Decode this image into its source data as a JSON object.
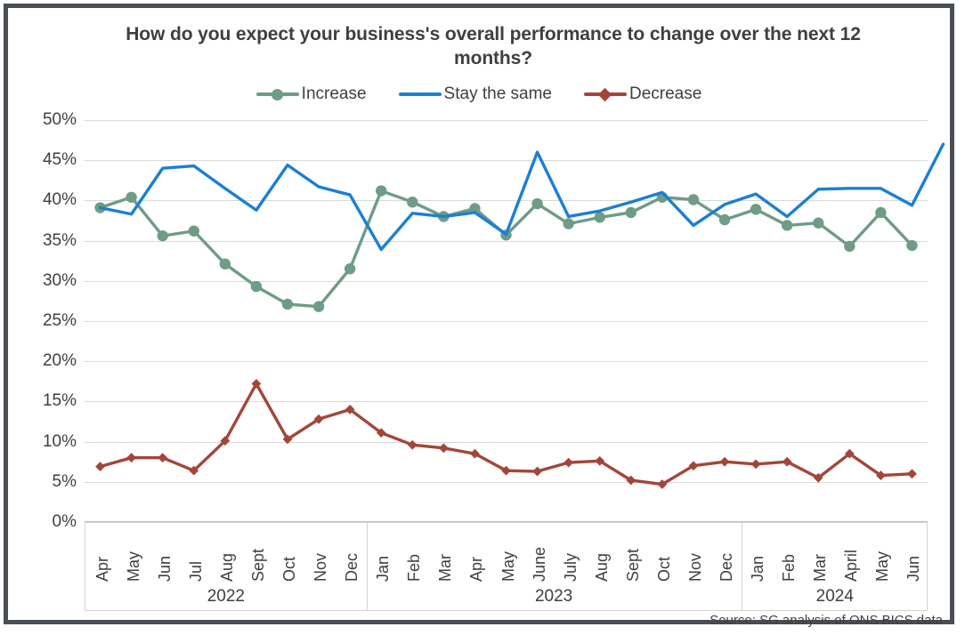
{
  "chart": {
    "title": "How do you expect your business's overall performance to change over the next 12 months?",
    "source": "Source: SG analysis of ONS BICS data"
  },
  "legend": {
    "items": [
      {
        "label": "Increase",
        "color": "#6e9c85",
        "marker": "circle"
      },
      {
        "label": "Stay the same",
        "color": "#1b7fd4",
        "marker": "line"
      },
      {
        "label": "Decrease",
        "color": "#a34639",
        "marker": "diamond"
      }
    ]
  },
  "yaxis": {
    "ticks": [
      "0%",
      "5%",
      "10%",
      "15%",
      "20%",
      "25%",
      "30%",
      "35%",
      "40%",
      "45%",
      "50%"
    ]
  },
  "years": [
    {
      "label": "2022",
      "count": 9
    },
    {
      "label": "2023",
      "count": 12
    },
    {
      "label": "2024",
      "count": 6
    }
  ],
  "chart_data": {
    "type": "line",
    "title": "How do you expect your business's overall performance to change over the next 12 months?",
    "xlabel": "",
    "ylabel": "",
    "ylim": [
      0,
      50
    ],
    "ytick_step": 5,
    "grid": true,
    "legend_position": "top",
    "categories": [
      "Apr 2022",
      "May 2022",
      "Jun 2022",
      "Jul 2022",
      "Aug 2022",
      "Sept 2022",
      "Oct 2022",
      "Nov 2022",
      "Dec 2022",
      "Jan 2023",
      "Feb 2023",
      "Mar 2023",
      "Apr 2023",
      "May 2023",
      "June 2023",
      "July 2023",
      "Aug 2023",
      "Sept 2023",
      "Oct 2023",
      "Nov 2023",
      "Dec 2023",
      "Jan 2024",
      "Feb 2024",
      "Mar 2024",
      "April 2024",
      "May 2024",
      "Jun 2024"
    ],
    "tick_labels": [
      "Apr",
      "May",
      "Jun",
      "Jul",
      "Aug",
      "Sept",
      "Oct",
      "Nov",
      "Dec",
      "Jan",
      "Feb",
      "Mar",
      "Apr",
      "May",
      "June",
      "July",
      "Aug",
      "Sept",
      "Oct",
      "Nov",
      "Dec",
      "Jan",
      "Feb",
      "Mar",
      "April",
      "May",
      "Jun"
    ],
    "series": [
      {
        "name": "Increase",
        "color": "#6e9c85",
        "marker": "circle",
        "values": [
          39.1,
          40.4,
          35.6,
          36.2,
          32.1,
          29.3,
          27.1,
          26.8,
          31.5,
          41.2,
          39.8,
          38.0,
          39.0,
          35.7,
          39.6,
          37.1,
          37.9,
          38.5,
          40.4,
          40.1,
          37.6,
          38.9,
          36.9,
          37.2,
          34.3,
          38.5,
          34.4
        ]
      },
      {
        "name": "Stay the same",
        "color": "#1b7fd4",
        "marker": "none",
        "values": [
          39.1,
          38.3,
          44.0,
          44.3,
          41.5,
          38.8,
          44.4,
          41.7,
          40.7,
          33.9,
          38.4,
          38.0,
          38.5,
          35.8,
          46.0,
          38.0,
          38.7,
          39.8,
          41.0,
          36.9,
          39.5,
          40.8,
          38.0,
          41.4,
          41.5,
          41.5,
          39.4,
          47.0
        ]
      },
      {
        "name": "Decrease",
        "color": "#a34639",
        "marker": "diamond",
        "values": [
          6.9,
          8.0,
          8.0,
          6.4,
          10.1,
          17.2,
          10.3,
          12.8,
          14.0,
          11.1,
          9.6,
          9.2,
          8.5,
          6.4,
          6.3,
          7.4,
          7.6,
          5.2,
          4.7,
          7.0,
          7.5,
          7.2,
          7.5,
          5.5,
          8.5,
          5.8,
          6.0
        ]
      }
    ]
  }
}
